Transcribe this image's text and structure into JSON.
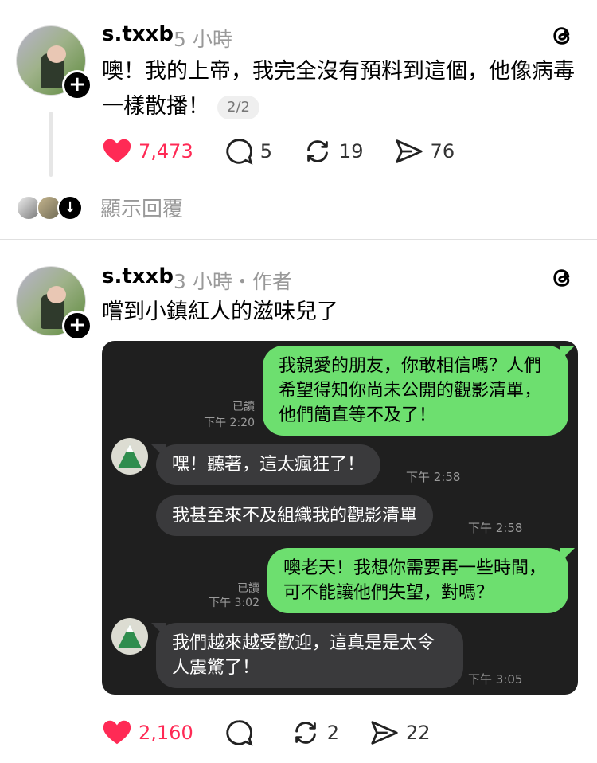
{
  "posts": [
    {
      "username": "s.txxb",
      "meta": "5 小時",
      "text": "噢！我的上帝，我完全沒有預料到這個，他像病毒一樣散播！",
      "page_badge": "2/2",
      "likes": "7,473",
      "comments": "5",
      "reposts": "19",
      "shares": "76",
      "show_replies": "顯示回覆"
    },
    {
      "username": "s.txxb",
      "meta": "3 小時・作者",
      "text": "嚐到小鎮紅人的滋味兒了",
      "likes": "2,160",
      "comments": "",
      "reposts": "2",
      "shares": "22"
    }
  ],
  "chat": {
    "messages": [
      {
        "dir": "out",
        "text": "我親愛的朋友，你敢相信嗎？人們希望得知你尚未公開的觀影清單，他們簡直等不及了！",
        "read": "已讀",
        "time": "下午 2:20"
      },
      {
        "dir": "in",
        "text": "嘿！聽著，這太瘋狂了！",
        "time": "下午 2:58"
      },
      {
        "dir": "in",
        "text": "我甚至來不及組織我的觀影清單",
        "time": "下午 2:58"
      },
      {
        "dir": "out",
        "text": "噢老天！我想你需要再一些時間，可不能讓他們失望，對嗎？",
        "read": "已讀",
        "time": "下午 3:02"
      },
      {
        "dir": "in",
        "text": "我們越來越受歡迎，這真是是太令人震驚了！",
        "time": "下午 3:05"
      }
    ]
  },
  "colors": {
    "like": "#ff2a55",
    "bubble_out": "#6ddf6f",
    "bubble_in": "#3a3a3c",
    "chat_bg": "#1f1f1f"
  },
  "icons": [
    "heart-icon",
    "comment-icon",
    "repost-icon",
    "share-icon",
    "threads-logo-icon",
    "plus-icon",
    "arrow-down-icon"
  ]
}
